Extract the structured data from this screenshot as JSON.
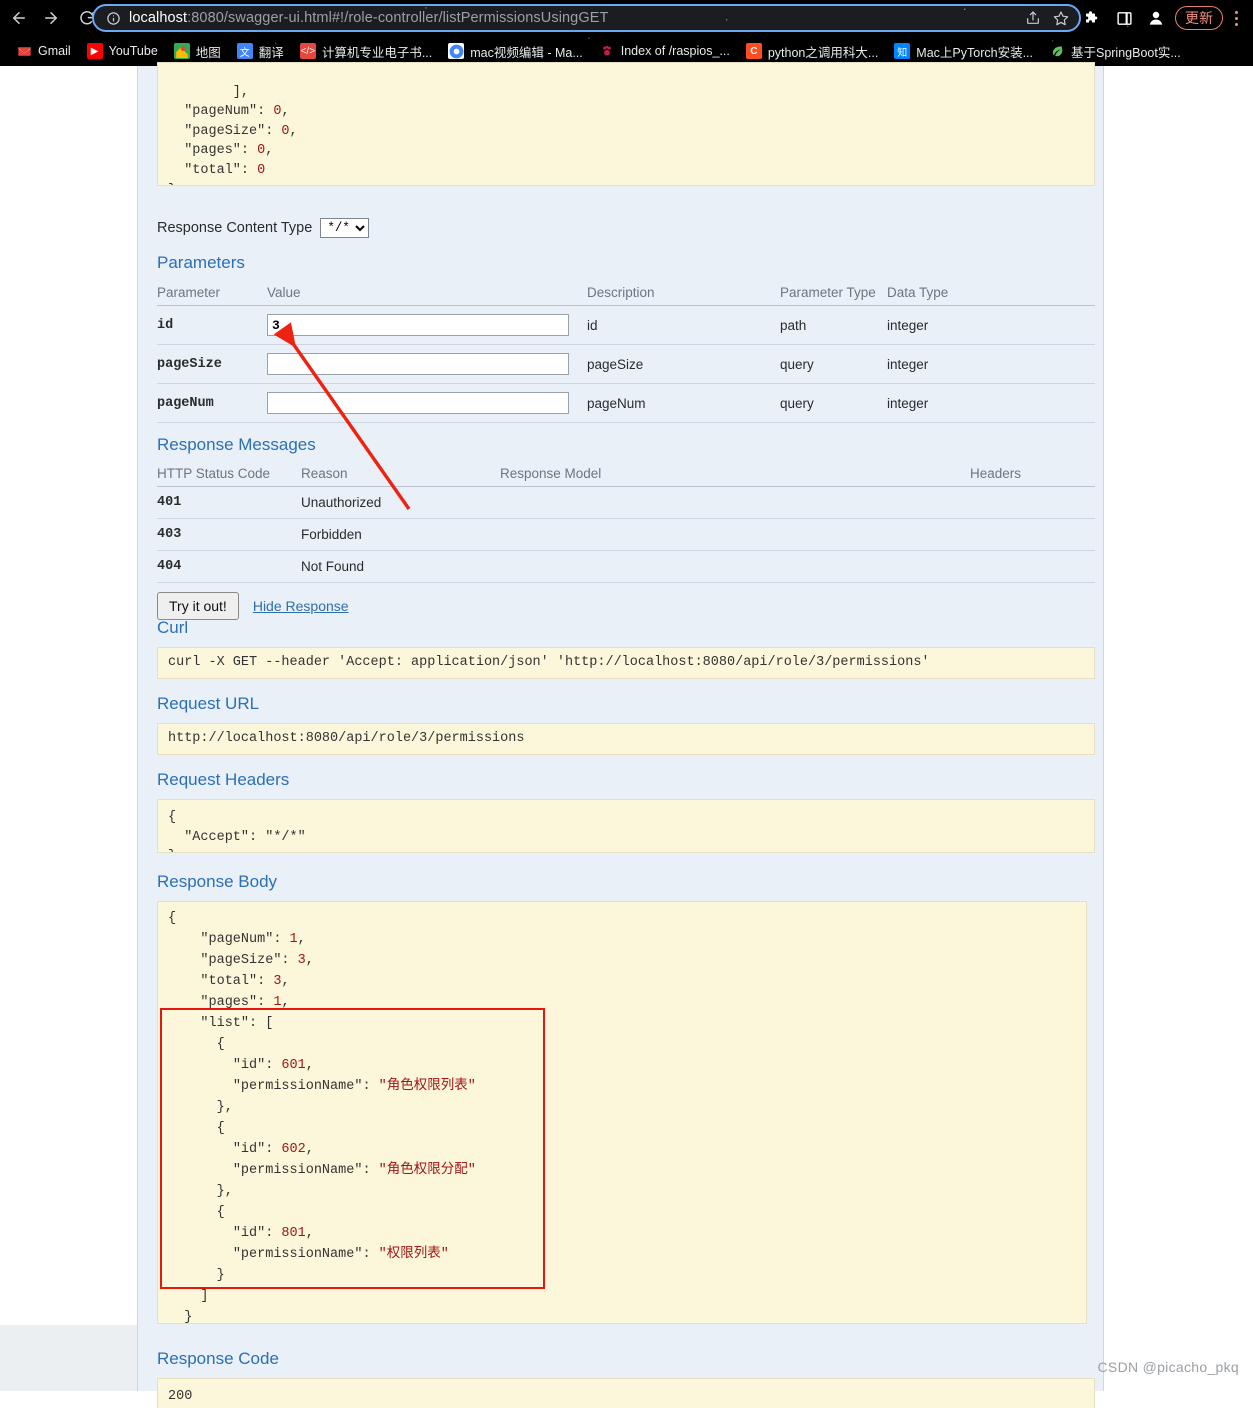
{
  "browser": {
    "url_prefix": "localhost",
    "url_rest": ":8080/swagger-ui.html#!/role-controller/listPermissionsUsingGET",
    "back_icon": "back-arrow-icon",
    "forward_icon": "forward-arrow-icon",
    "reload_icon": "reload-icon",
    "info_icon": "site-info-icon",
    "share_icon": "share-icon",
    "bookmark_icon": "star-icon",
    "extensions_icon": "puzzle-piece-icon",
    "sidepanel_icon": "side-panel-icon",
    "profile_icon": "profile-avatar-icon",
    "update_label": "更新",
    "menu_icon": "kebab-menu-icon",
    "bookmarks": [
      {
        "label": "Gmail",
        "icon": "gmail-icon",
        "glyph": "M"
      },
      {
        "label": "YouTube",
        "icon": "youtube-icon",
        "glyph": "▶"
      },
      {
        "label": "地图",
        "icon": "google-maps-icon",
        "glyph": "📍"
      },
      {
        "label": "翻译",
        "icon": "translate-icon",
        "glyph": "文"
      },
      {
        "label": "计算机专业电子书...",
        "icon": "code-icon",
        "glyph": "</>"
      },
      {
        "label": "mac视频编辑 - Ma...",
        "icon": "chrome-icon",
        "glyph": "◉"
      },
      {
        "label": "Index of /raspios_...",
        "icon": "raspberry-pi-icon",
        "glyph": "✿"
      },
      {
        "label": "python之调用科大...",
        "icon": "csdn-icon",
        "glyph": "C"
      },
      {
        "label": "Mac上PyTorch安装...",
        "icon": "zhihu-icon",
        "glyph": "知"
      },
      {
        "label": "基于SpringBoot实...",
        "icon": "leaf-icon",
        "glyph": "🍃"
      }
    ]
  },
  "model_schema": {
    "lines": [
      "  ],",
      "  \"pageNum\": 0,",
      "  \"pageSize\": 0,",
      "  \"pages\": 0,",
      "  \"total\": 0",
      "}"
    ]
  },
  "response_content_type": {
    "label": "Response Content Type",
    "selected": "*/*",
    "options": [
      "*/*"
    ]
  },
  "parameters": {
    "title": "Parameters",
    "headers": [
      "Parameter",
      "Value",
      "Description",
      "Parameter Type",
      "Data Type"
    ],
    "rows": [
      {
        "parameter": "id",
        "value": "3",
        "description": "id",
        "parameter_type": "path",
        "data_type": "integer"
      },
      {
        "parameter": "pageSize",
        "value": "",
        "description": "pageSize",
        "parameter_type": "query",
        "data_type": "integer"
      },
      {
        "parameter": "pageNum",
        "value": "",
        "description": "pageNum",
        "parameter_type": "query",
        "data_type": "integer"
      }
    ]
  },
  "response_messages": {
    "title": "Response Messages",
    "headers": [
      "HTTP Status Code",
      "Reason",
      "Response Model",
      "Headers"
    ],
    "rows": [
      {
        "code": "401",
        "reason": "Unauthorized",
        "model": "",
        "headers": ""
      },
      {
        "code": "403",
        "reason": "Forbidden",
        "model": "",
        "headers": ""
      },
      {
        "code": "404",
        "reason": "Not Found",
        "model": "",
        "headers": ""
      }
    ],
    "try_it_label": "Try it out!",
    "hide_response_label": "Hide Response"
  },
  "curl": {
    "title": "Curl",
    "command": "curl -X GET --header 'Accept: application/json' 'http://localhost:8080/api/role/3/permissions'"
  },
  "request_url": {
    "title": "Request URL",
    "url": "http://localhost:8080/api/role/3/permissions"
  },
  "request_headers": {
    "title": "Request Headers",
    "body": "{\n  \"Accept\": \"*/*\"\n}"
  },
  "response_body": {
    "title": "Response Body",
    "page_num_key": "\"pageNum\"",
    "page_num_val": "1",
    "page_size_key": "\"pageSize\"",
    "page_size_val": "3",
    "total_key": "\"total\"",
    "total_val": "3",
    "pages_key": "\"pages\"",
    "pages_val": "1",
    "list_key": "\"list\"",
    "items": [
      {
        "id_key": "\"id\"",
        "id": "601",
        "name_key": "\"permissionName\"",
        "name": "\"角色权限列表\""
      },
      {
        "id_key": "\"id\"",
        "id": "602",
        "name_key": "\"permissionName\"",
        "name": "\"角色权限分配\""
      },
      {
        "id_key": "\"id\"",
        "id": "801",
        "name_key": "\"permissionName\"",
        "name": "\"权限列表\""
      }
    ]
  },
  "response_code": {
    "title": "Response Code",
    "value": "200"
  },
  "annotations": {
    "arrow_color": "#ee2211",
    "rect_color": "#e8170e",
    "arrow_note": "arrow pointing to id value field"
  },
  "watermark": "CSDN @picacho_pkq"
}
